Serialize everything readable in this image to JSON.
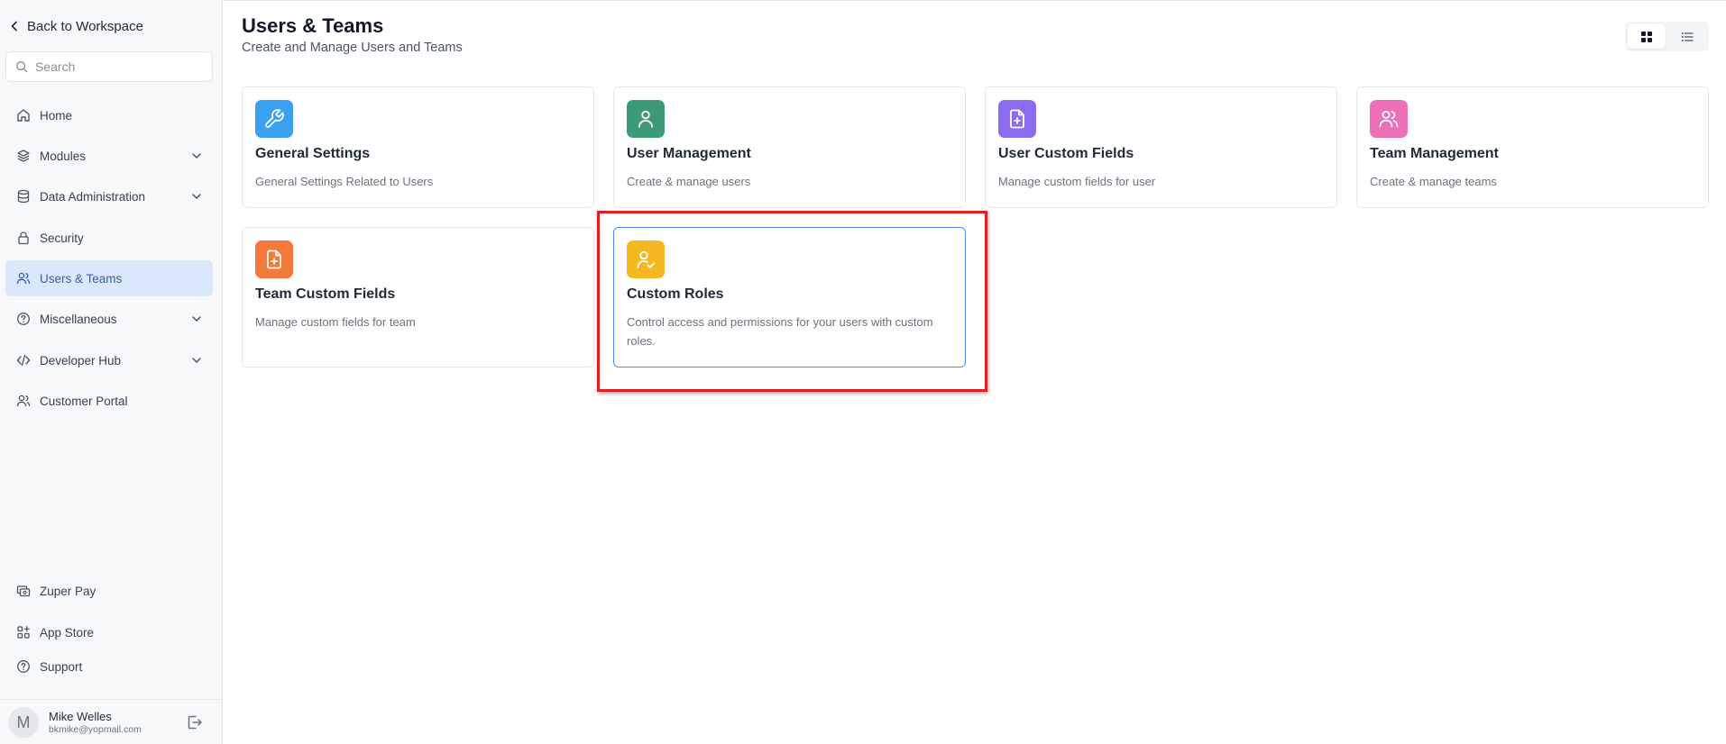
{
  "sidebar": {
    "back_label": "Back to Workspace",
    "search_placeholder": "Search",
    "items": [
      {
        "label": "Home"
      },
      {
        "label": "Modules"
      },
      {
        "label": "Data Administration"
      },
      {
        "label": "Security"
      },
      {
        "label": "Users & Teams",
        "active": true
      },
      {
        "label": "Miscellaneous"
      },
      {
        "label": "Developer Hub"
      },
      {
        "label": "Customer Portal"
      }
    ],
    "bottom_items": [
      {
        "label": "Zuper Pay"
      },
      {
        "label": "App Store"
      },
      {
        "label": "Support"
      }
    ],
    "user": {
      "initial": "M",
      "name": "Mike Welles",
      "email": "bkmike@yopmail.com"
    }
  },
  "header": {
    "title": "Users & Teams",
    "subtitle": "Create and Manage Users and Teams"
  },
  "view_toggle": {
    "selected": "grid"
  },
  "cards": [
    {
      "title": "General Settings",
      "description": "General Settings Related to Users",
      "icon": "wrench-icon",
      "color": "#3aa0f0"
    },
    {
      "title": "User Management",
      "description": "Create & manage users",
      "icon": "user-icon",
      "color": "#3d9a76"
    },
    {
      "title": "User Custom Fields",
      "description": "Manage custom fields for user",
      "icon": "file-plus-icon",
      "color": "#8b6cf0"
    },
    {
      "title": "Team Management",
      "description": "Create & manage teams",
      "icon": "users-icon",
      "color": "#ec6fb7"
    },
    {
      "title": "Team Custom Fields",
      "description": "Manage custom fields for team",
      "icon": "file-plus-icon",
      "color": "#f57a3a"
    },
    {
      "title": "Custom Roles",
      "description": "Control access and permissions for your users with custom roles.",
      "icon": "user-check-icon",
      "color": "#f5b820"
    }
  ],
  "colors": {
    "active_nav_bg": "#dbe7fb",
    "active_nav_text": "#3b5ea8",
    "selected_card_border": "#4f86f0",
    "highlight_box": "#e02020"
  }
}
